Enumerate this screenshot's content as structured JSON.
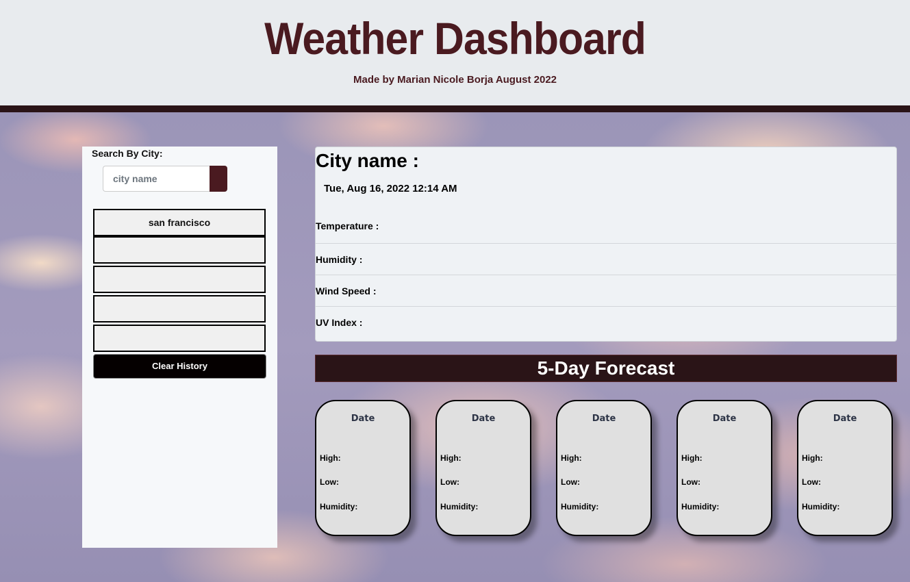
{
  "header": {
    "title": "Weather Dashboard",
    "byline": "Made by Marian Nicole Borja August 2022"
  },
  "search": {
    "label": "Search By City:",
    "placeholder": "city name",
    "value": ""
  },
  "history": {
    "items": [
      "san francisco",
      "",
      "",
      "",
      ""
    ],
    "clear_label": "Clear History"
  },
  "current": {
    "city_label": "City name :",
    "datetime": "Tue, Aug 16, 2022 12:14 AM",
    "temperature_label": "Temperature :",
    "humidity_label": "Humidity :",
    "wind_label": "Wind Speed :",
    "uv_label": "UV Index :"
  },
  "forecast": {
    "heading": "5-Day Forecast",
    "days": [
      {
        "date": "Date",
        "high": "High:",
        "low": "Low:",
        "humidity": "Humidity:"
      },
      {
        "date": "Date",
        "high": "High:",
        "low": "Low:",
        "humidity": "Humidity:"
      },
      {
        "date": "Date",
        "high": "High:",
        "low": "Low:",
        "humidity": "Humidity:"
      },
      {
        "date": "Date",
        "high": "High:",
        "low": "Low:",
        "humidity": "Humidity:"
      },
      {
        "date": "Date",
        "high": "High:",
        "low": "Low:",
        "humidity": "Humidity:"
      }
    ]
  },
  "colors": {
    "brand": "#4a1a20",
    "header_bar": "#2a1417",
    "card_bg": "#e0e0e0"
  }
}
